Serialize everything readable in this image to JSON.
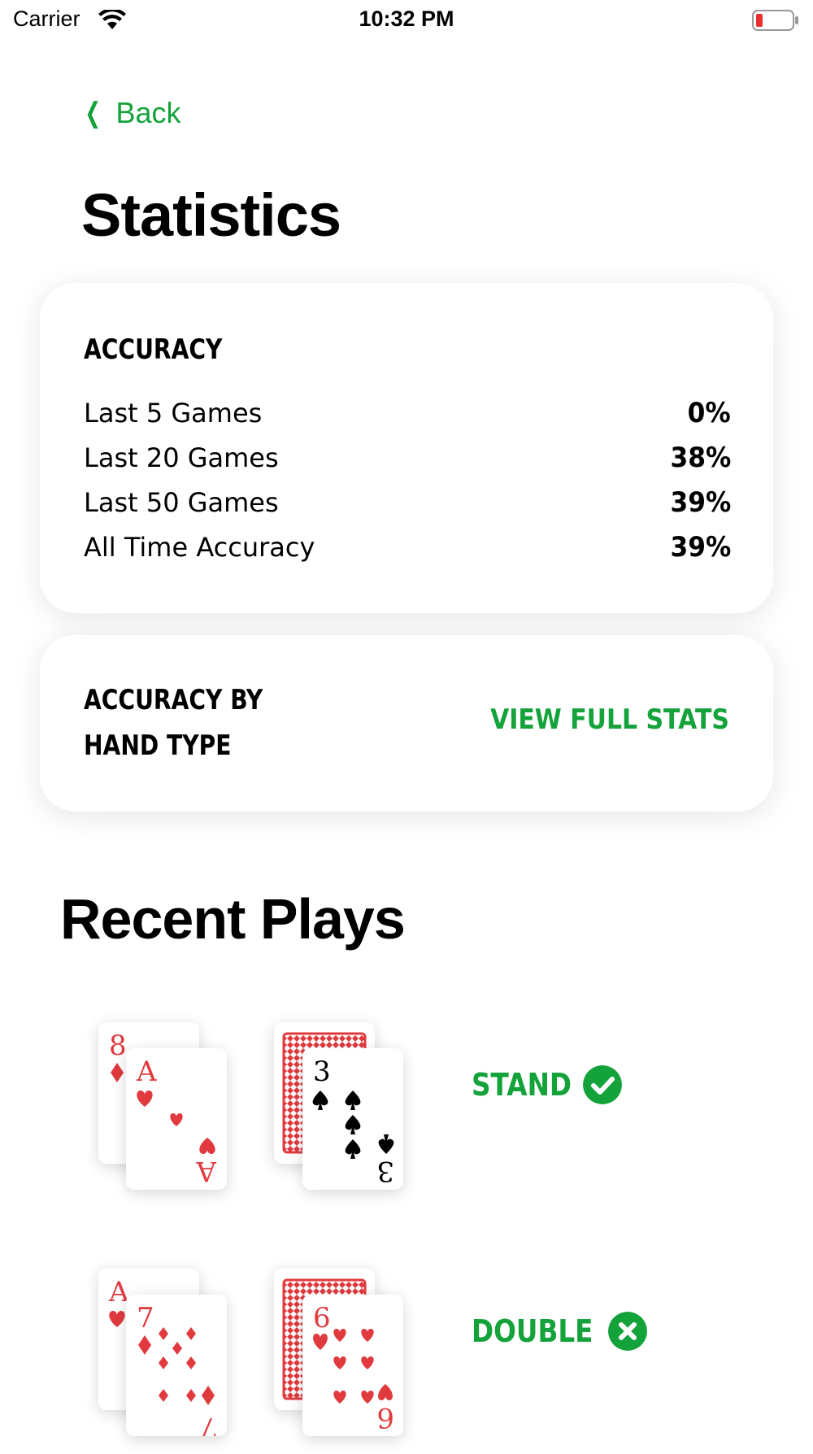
{
  "status_bar": {
    "carrier": "Carrier",
    "time": "10:32 PM"
  },
  "nav": {
    "back_label": "Back"
  },
  "page_title": "Statistics",
  "accuracy_card": {
    "heading": "ACCURACY",
    "rows": [
      {
        "label": "Last 5 Games",
        "value": "0%"
      },
      {
        "label": "Last 20 Games",
        "value": "38%"
      },
      {
        "label": "Last 50 Games",
        "value": "39%"
      },
      {
        "label": "All Time Accuracy",
        "value": "39%"
      }
    ]
  },
  "hand_type_card": {
    "heading_line1": "ACCURACY BY",
    "heading_line2": "HAND TYPE",
    "link_label": "VIEW FULL STATS"
  },
  "recent_title": "Recent Plays",
  "recent_plays": [
    {
      "player_cards": [
        {
          "rank": "8",
          "suit": "diamonds"
        },
        {
          "rank": "A",
          "suit": "hearts"
        }
      ],
      "dealer_cards": [
        {
          "rank": "",
          "suit": "face-down"
        },
        {
          "rank": "3",
          "suit": "spades"
        }
      ],
      "action": "STAND",
      "result_icon": "check-circle-icon"
    },
    {
      "player_cards": [
        {
          "rank": "A",
          "suit": "hearts"
        },
        {
          "rank": "7",
          "suit": "diamonds"
        }
      ],
      "dealer_cards": [
        {
          "rank": "",
          "suit": "face-down"
        },
        {
          "rank": "6",
          "suit": "hearts"
        }
      ],
      "action": "DOUBLE",
      "result_icon": "x-circle-icon"
    }
  ],
  "colors": {
    "accent": "#14a23a",
    "red_suit": "#e03a3e",
    "black_suit": "#000000",
    "battery_low": "#e8302c"
  }
}
